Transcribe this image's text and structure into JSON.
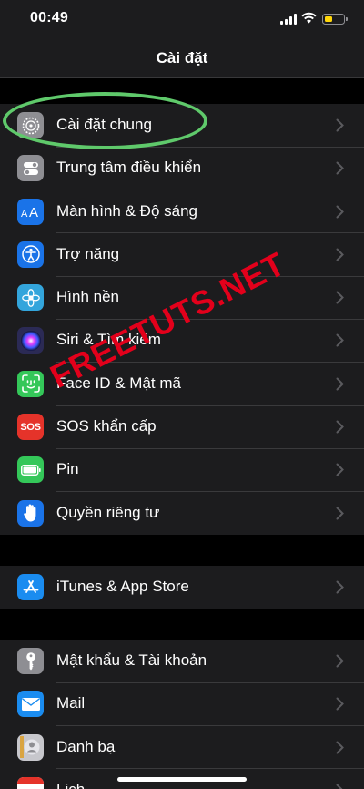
{
  "status_bar": {
    "time": "00:49"
  },
  "nav": {
    "title": "Cài đặt"
  },
  "groups": [
    {
      "items": [
        {
          "label": "Cài đặt chung",
          "icon": "gear-icon",
          "color": "#8e8e93"
        },
        {
          "label": "Trung tâm điều khiển",
          "icon": "toggles-icon",
          "color": "#8e8e93"
        },
        {
          "label": "Màn hình & Độ sáng",
          "icon": "text-size-icon",
          "color": "#1a73e8"
        },
        {
          "label": "Trợ năng",
          "icon": "accessibility-icon",
          "color": "#1a73e8"
        },
        {
          "label": "Hình nền",
          "icon": "flower-icon",
          "color": "#33a5dc"
        },
        {
          "label": "Siri & Tìm kiếm",
          "icon": "siri-icon",
          "color": "#2b2a55"
        },
        {
          "label": "Face ID & Mật mã",
          "icon": "face-id-icon",
          "color": "#34c759"
        },
        {
          "label": "SOS khẩn cấp",
          "icon": "sos-icon",
          "color": "#e5332a",
          "icon_text": "SOS"
        },
        {
          "label": "Pin",
          "icon": "battery-icon",
          "color": "#34c759"
        },
        {
          "label": "Quyền riêng tư",
          "icon": "hand-icon",
          "color": "#1a73e8"
        }
      ]
    },
    {
      "items": [
        {
          "label": "iTunes & App Store",
          "icon": "app-store-icon",
          "color": "#1a8cf0"
        }
      ]
    },
    {
      "items": [
        {
          "label": "Mật khẩu & Tài khoản",
          "icon": "key-icon",
          "color": "#8e8e93"
        },
        {
          "label": "Mail",
          "icon": "mail-icon",
          "color": "#1a8cf0"
        },
        {
          "label": "Danh bạ",
          "icon": "contacts-icon",
          "color": "#c7c7cc"
        },
        {
          "label": "Lịch",
          "icon": "calendar-icon",
          "color": "#ffffff"
        }
      ]
    }
  ],
  "watermark": "FREETUTS.NET",
  "colors": {
    "background": "#000000",
    "cell": "#1c1c1e",
    "separator": "#3a3a3c",
    "chevron": "#5a5a5e",
    "highlight": "#5fc96b",
    "watermark": "#e3001b"
  }
}
